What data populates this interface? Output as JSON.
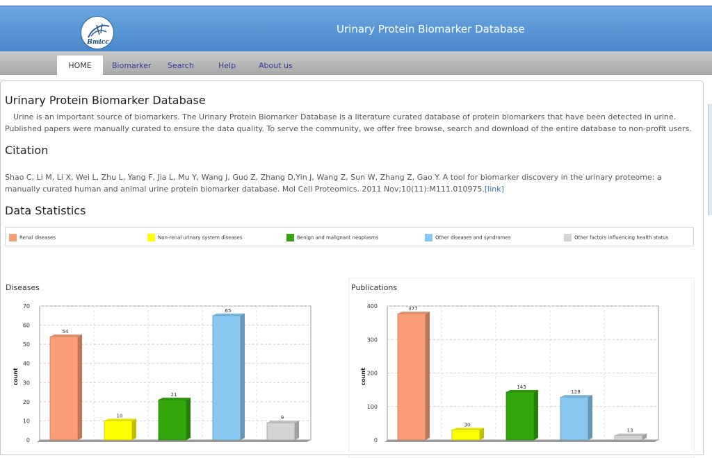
{
  "header": {
    "logo_text": "Bmicc",
    "site_title": "Urinary Protein Biomarker Database"
  },
  "nav": {
    "items": [
      {
        "label": "HOME",
        "active": true
      },
      {
        "label": "Biomarker",
        "active": false
      },
      {
        "label": "Search",
        "active": false
      },
      {
        "label": "Help",
        "active": false
      },
      {
        "label": "About us",
        "active": false
      }
    ]
  },
  "main": {
    "title": "Urinary Protein Biomarker Database",
    "intro": "Urine is an important source of biomarkers. The Urinary Protein Biomarker Database is a literature curated database of protein biomarkers that have been detected in urine. Published papers were manually curated to ensure the data quality. To serve the community, we offer free browse, search and download of the entire database to non-profit users.",
    "citation_heading": "Citation",
    "citation_text": "Shao C, Li M, Li X, Wei L, Zhu L, Yang F, Jia L, Mu Y, Wang J, Guo Z, Zhang D,Yin J, Wang Z, Sun W, Zhang Z, Gao Y. A tool for biomarker discovery in the urinary proteome: a manually curated human and animal urine protein biomarker database. Mol Cell Proteomics. 2011 Nov;10(11):M111.010975.",
    "citation_link": "[link]",
    "stats_heading": "Data Statistics"
  },
  "legend": [
    {
      "label": "Renal diseases",
      "color": "#fa9e78"
    },
    {
      "label": "Non-renal urinary system diseases",
      "color": "#ffff00"
    },
    {
      "label": "Benign and malignant neoplasms",
      "color": "#33a60c"
    },
    {
      "label": "Other diseases and syndromes",
      "color": "#88c8f0"
    },
    {
      "label": "Other factors influencing health status",
      "color": "#d4d4d4"
    }
  ],
  "chart_data": [
    {
      "type": "bar",
      "title": "Diseases",
      "ylabel": "count",
      "categories": [
        "Renal diseases",
        "Non-renal urinary system diseases",
        "Benign and malignant neoplasms",
        "Other diseases and syndromes",
        "Other factors influencing health status"
      ],
      "values": [
        54,
        10,
        21,
        65,
        9
      ],
      "colors": [
        "#fa9e78",
        "#ffff00",
        "#33a60c",
        "#88c8f0",
        "#d4d4d4"
      ],
      "yticks": [
        0,
        10,
        20,
        30,
        40,
        50,
        60,
        70
      ],
      "ylim": [
        0,
        70
      ],
      "grid": true
    },
    {
      "type": "bar",
      "title": "Publications",
      "ylabel": "count",
      "categories": [
        "Renal diseases",
        "Non-renal urinary system diseases",
        "Benign and malignant neoplasms",
        "Other diseases and syndromes",
        "Other factors influencing health status"
      ],
      "values": [
        377,
        30,
        143,
        128,
        13
      ],
      "colors": [
        "#fa9e78",
        "#ffff00",
        "#33a60c",
        "#88c8f0",
        "#d4d4d4"
      ],
      "yticks": [
        0,
        100,
        200,
        300,
        400
      ],
      "ylim": [
        0,
        400
      ],
      "grid": true
    }
  ]
}
